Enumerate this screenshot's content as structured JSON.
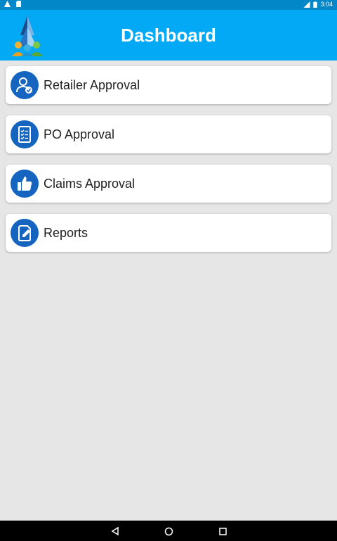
{
  "status_bar": {
    "time": "3:04"
  },
  "app_bar": {
    "title": "Dashboard"
  },
  "menu": [
    {
      "label": "Retailer Approval",
      "icon": "user-check-icon"
    },
    {
      "label": "PO Approval",
      "icon": "checklist-icon"
    },
    {
      "label": "Claims Approval",
      "icon": "thumbs-up-icon"
    },
    {
      "label": "Reports",
      "icon": "edit-document-icon"
    }
  ],
  "colors": {
    "app_bar": "#03a9f4",
    "status_bar": "#0288c9",
    "icon_bg": "#1565c0",
    "background": "#e6e6e6"
  }
}
